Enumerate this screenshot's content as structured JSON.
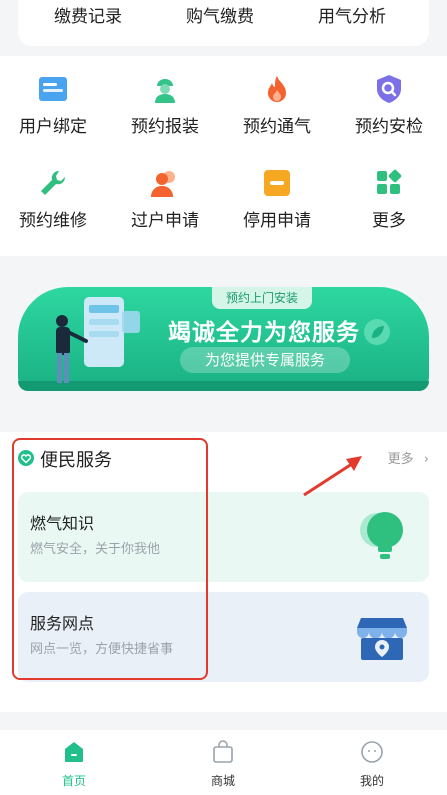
{
  "top_tabs": [
    "缴费记录",
    "购气缴费",
    "用气分析"
  ],
  "grid_items": [
    {
      "label": "用户绑定",
      "icon": "id-card-icon"
    },
    {
      "label": "预约报装",
      "icon": "worker-icon"
    },
    {
      "label": "预约通气",
      "icon": "flame-icon"
    },
    {
      "label": "预约安检",
      "icon": "shield-icon"
    },
    {
      "label": "预约维修",
      "icon": "wrench-icon"
    },
    {
      "label": "过户申请",
      "icon": "users-icon"
    },
    {
      "label": "停用申请",
      "icon": "stop-icon"
    },
    {
      "label": "更多",
      "icon": "apps-icon"
    }
  ],
  "banner": {
    "tag": "预约上门安装",
    "title": "竭诚全力为您服务",
    "subtitle": "为您提供专属服务"
  },
  "services": {
    "title": "便民服务",
    "more": "更多",
    "cards": [
      {
        "title": "燃气知识",
        "subtitle": "燃气安全，关于你我他"
      },
      {
        "title": "服务网点",
        "subtitle": "网点一览，方便快捷省事"
      }
    ]
  },
  "bottom_nav": [
    {
      "label": "首页",
      "active": true
    },
    {
      "label": "商城",
      "active": false
    },
    {
      "label": "我的",
      "active": false
    }
  ],
  "colors": {
    "accent": "#21c08b",
    "annotation": "#e23b2e"
  }
}
